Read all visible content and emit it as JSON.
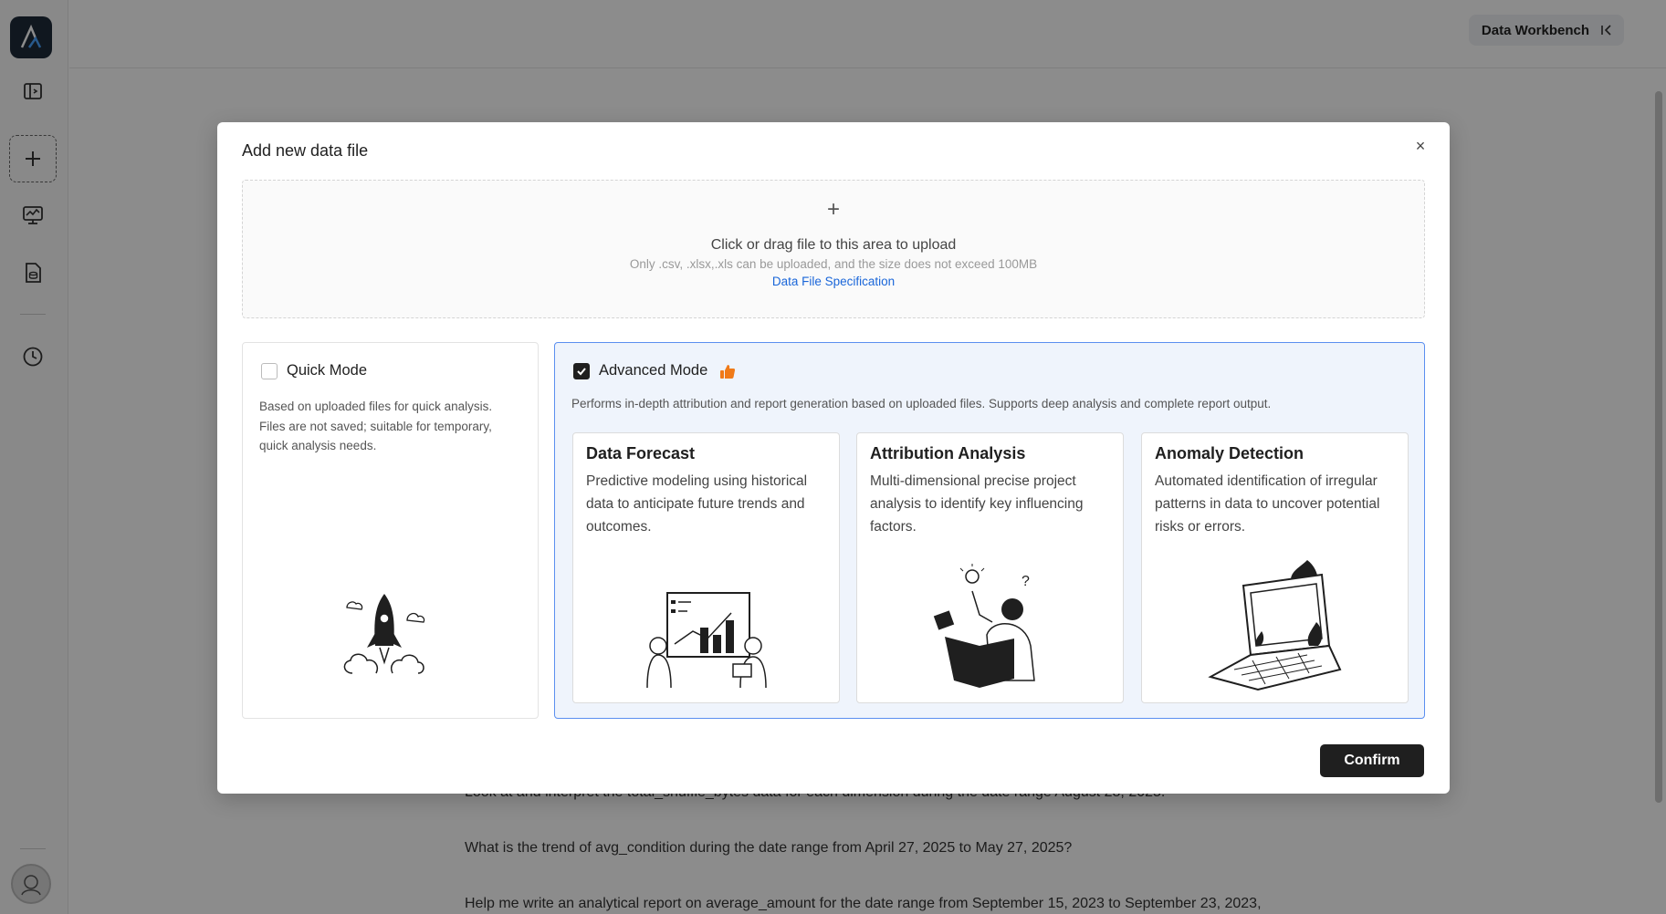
{
  "header": {
    "workbench_label": "Data Workbench"
  },
  "background_questions": [
    "Look at and interpret the total_shuffle_bytes data for each dimension during the date range August 28, 2025.",
    "What is the trend of avg_condition during the date range from April 27, 2025 to May 27, 2025?",
    "Help me write an analytical report on average_amount for the date range from September 15, 2023 to September 23, 2023,"
  ],
  "modal": {
    "title": "Add new data file",
    "close_label": "×",
    "upload": {
      "plus": "+",
      "main_text": "Click or drag file to this area to upload",
      "sub_text": "Only .csv, .xlsx,.xls can be uploaded, and the size does not exceed 100MB",
      "link_text": "Data File Specification"
    },
    "quick_mode": {
      "label": "Quick Mode",
      "checked": false,
      "description": "Based on uploaded files for quick analysis. Files are not saved; suitable for temporary, quick analysis needs."
    },
    "advanced_mode": {
      "label": "Advanced Mode",
      "checked": true,
      "description": "Performs in-depth attribution and report generation based on uploaded files. Supports deep analysis and complete report output.",
      "features": [
        {
          "title": "Data Forecast",
          "description": "Predictive modeling using historical data to anticipate future trends and outcomes."
        },
        {
          "title": "Attribution Analysis",
          "description": "Multi-dimensional precise project analysis to identify key influencing factors."
        },
        {
          "title": "Anomaly Detection",
          "description": "Automated identification of irregular patterns in data to uncover potential risks or errors."
        }
      ]
    },
    "confirm_label": "Confirm"
  },
  "colors": {
    "accent_blue": "#1a66d9",
    "advanced_bg": "#eff4fc",
    "advanced_border": "#5b8ff0",
    "thumb_orange": "#f07a18",
    "confirm_bg": "#1f1f1f"
  }
}
